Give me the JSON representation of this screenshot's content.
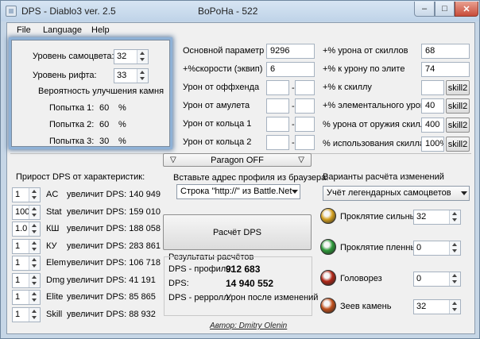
{
  "window": {
    "title_left": "DPS - Diablo3 ver. 2.5",
    "title_mid": "BoPoHa - 522",
    "min_glyph": "–",
    "max_glyph": "□",
    "close_glyph": "✕"
  },
  "menu": [
    "File",
    "Language",
    "Help"
  ],
  "gem_panel": {
    "gem_level_label": "Уровень самоцвета:",
    "gem_level_value": "32",
    "rift_level_label": "Уровень рифта:",
    "rift_level_value": "33",
    "upgrade_chance_label": "Вероятность улучшения камня",
    "attempts": [
      {
        "label": "Попытка 1:",
        "value": "60",
        "unit": "%"
      },
      {
        "label": "Попытка 2:",
        "value": "60",
        "unit": "%"
      },
      {
        "label": "Попытка 3:",
        "value": "30",
        "unit": "%"
      }
    ]
  },
  "params_left": [
    {
      "label": "Основной параметр",
      "value": "9296"
    },
    {
      "label": "+%скорости (эквип)",
      "value": "6"
    },
    {
      "label": "Урон от оффхенда",
      "value1": "",
      "value2": ""
    },
    {
      "label": "Урон от амулета",
      "value1": "",
      "value2": ""
    },
    {
      "label": "Урон от кольца 1",
      "value1": "",
      "value2": ""
    },
    {
      "label": "Урон от кольца 2",
      "value1": "",
      "value2": ""
    }
  ],
  "dash": "-",
  "params_right": [
    {
      "label": "+% урона от скиллов",
      "value": "68"
    },
    {
      "label": "+% к урону по элите",
      "value": "74"
    },
    {
      "label": "+% к скиллу",
      "value": "",
      "skill_button": "skill2"
    },
    {
      "label": "+% элементального урона",
      "value": "40",
      "skill_button": "skill2"
    },
    {
      "label": "% урона от оружия скилла",
      "value": "400",
      "skill_button": "skill2"
    },
    {
      "label": "% использования скилла",
      "value": "100%",
      "skill_button": "skill2"
    }
  ],
  "paragon_label": "Paragon OFF",
  "dps_gain": {
    "title": "Прирост DPS от характеристик:",
    "rows": [
      {
        "qty": "1",
        "stat": "AC",
        "text": "увеличит DPS: 140 949"
      },
      {
        "qty": "100",
        "stat": "Stat",
        "text": "увеличит DPS: 159 010"
      },
      {
        "qty": "1.0",
        "stat": "КШ",
        "text": "увеличит DPS: 188 058"
      },
      {
        "qty": "1",
        "stat": "КУ",
        "text": "увеличит DPS: 283 861"
      },
      {
        "qty": "1",
        "stat": "Elem",
        "text": "увеличит DPS: 106 718"
      },
      {
        "qty": "1",
        "stat": "Dmg",
        "text": "увеличит DPS: 41 191"
      },
      {
        "qty": "1",
        "stat": "Elite",
        "text": "увеличит DPS: 85 865"
      },
      {
        "qty": "1",
        "stat": "Skill",
        "text": "увеличит DPS: 88 932"
      }
    ]
  },
  "profile": {
    "label": "Вставьте адрес профиля из браузера:",
    "combo_value": "Строка \"http://\" из Battle.Net",
    "calc_button": "Расчёт DPS"
  },
  "results": {
    "title": "Результаты расчётов",
    "rows": [
      {
        "label": "DPS - профиль:",
        "value": "912 683"
      },
      {
        "label": "DPS:",
        "value": "14 940 552"
      },
      {
        "label": "DPS - рерролл:",
        "value": "Урон после изменений"
      }
    ]
  },
  "variants": {
    "title": "Варианты расчёта изменений",
    "combo_value": "Учёт легендарных самоцветов",
    "gems": [
      {
        "name": "Проклятие сильных",
        "value": "32",
        "color": "#d4a020"
      },
      {
        "name": "Проклятие пленных",
        "value": "0",
        "color": "#2e9a3a"
      },
      {
        "name": "Головорез",
        "value": "0",
        "color": "#b02818"
      },
      {
        "name": "Зеев камень",
        "value": "32",
        "color": "#c0501c"
      }
    ]
  },
  "author": "Автор: Dmitry Olenin"
}
